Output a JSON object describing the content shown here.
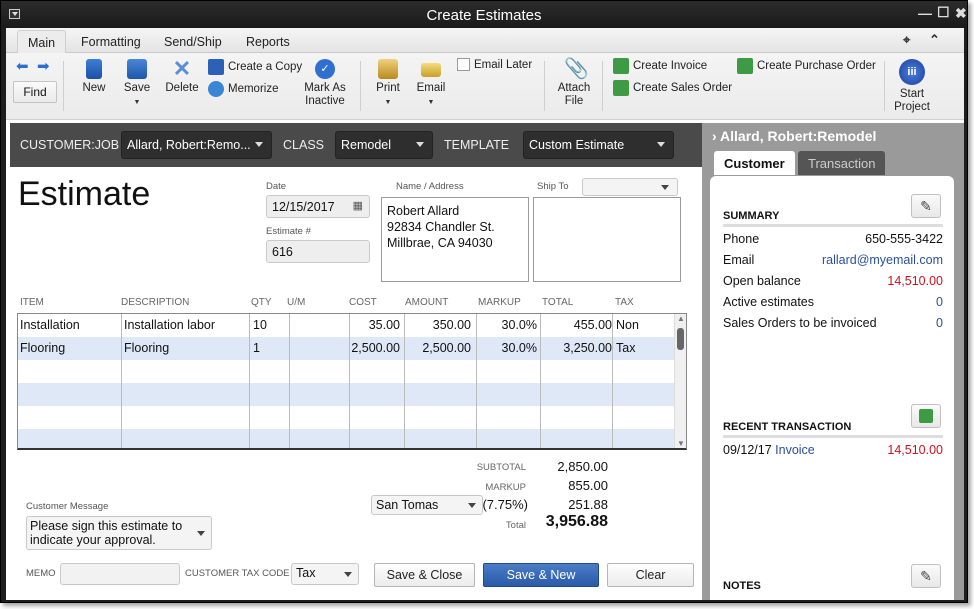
{
  "window": {
    "title": "Create Estimates"
  },
  "tabs": [
    {
      "label": "Main",
      "active": true
    },
    {
      "label": "Formatting",
      "active": false
    },
    {
      "label": "Send/Ship",
      "active": false
    },
    {
      "label": "Reports",
      "active": false
    }
  ],
  "ribbon": {
    "find": "Find",
    "new": "New",
    "save": "Save",
    "delete": "Delete",
    "create_copy": "Create a Copy",
    "memorize": "Memorize",
    "mark_inactive_1": "Mark As",
    "mark_inactive_2": "Inactive",
    "print": "Print",
    "email": "Email",
    "email_later": "Email Later",
    "attach_1": "Attach",
    "attach_2": "File",
    "create_invoice": "Create Invoice",
    "create_sales_order": "Create Sales Order",
    "create_po": "Create Purchase Order",
    "start_project_1": "Start",
    "start_project_2": "Project"
  },
  "customer_bar": {
    "customer_job_label": "CUSTOMER:JOB",
    "customer_job_value": "Allard, Robert:Remo...",
    "class_label": "CLASS",
    "class_value": "Remodel",
    "template_label": "TEMPLATE",
    "template_value": "Custom Estimate"
  },
  "form": {
    "title": "Estimate",
    "date_label": "Date",
    "date_value": "12/15/2017",
    "estimate_no_label": "Estimate #",
    "estimate_no_value": "616",
    "name_address_label": "Name / Address",
    "address_lines": [
      "Robert Allard",
      "92834 Chandler St.",
      "Millbrae, CA 94030"
    ],
    "ship_to_label": "Ship To",
    "ship_to_value": ""
  },
  "grid": {
    "columns": [
      "ITEM",
      "DESCRIPTION",
      "QTY",
      "U/M",
      "COST",
      "AMOUNT",
      "MARKUP",
      "TOTAL",
      "TAX"
    ],
    "rows": [
      {
        "item": "Installation",
        "description": "Installation labor",
        "qty": "10",
        "um": "",
        "cost": "35.00",
        "amount": "350.00",
        "markup": "30.0%",
        "total": "455.00",
        "tax": "Non"
      },
      {
        "item": "Flooring",
        "description": "Flooring",
        "qty": "1",
        "um": "",
        "cost": "2,500.00",
        "amount": "2,500.00",
        "markup": "30.0%",
        "total": "3,250.00",
        "tax": "Tax"
      }
    ]
  },
  "totals": {
    "subtotal_label": "SUBTOTAL",
    "subtotal_value": "2,850.00",
    "markup_label": "MARKUP",
    "markup_value": "855.00",
    "tax_item": "San Tomas",
    "tax_rate": "(7.75%)",
    "tax_value": "251.88",
    "total_label": "Total",
    "total_value": "3,956.88"
  },
  "footer": {
    "customer_message_label": "Customer Message",
    "customer_message_value": "Please sign this estimate to indicate your approval.",
    "memo_label": "MEMO",
    "memo_value": "",
    "tax_code_label": "CUSTOMER TAX CODE",
    "tax_code_value": "Tax",
    "save_close": "Save & Close",
    "save_new": "Save & New",
    "clear": "Clear"
  },
  "sidebar": {
    "header": "Allard, Robert:Remodel",
    "tabs": [
      "Customer",
      "Transaction"
    ],
    "summary_title": "SUMMARY",
    "summary": [
      {
        "label": "Phone",
        "value": "650-555-3422"
      },
      {
        "label": "Email",
        "value": "rallard@myemail.com"
      },
      {
        "label": "Open balance",
        "value": "14,510.00"
      },
      {
        "label": "Active estimates",
        "value": "0"
      },
      {
        "label": "Sales Orders to be invoiced",
        "value": "0"
      }
    ],
    "recent_title": "RECENT TRANSACTION",
    "recent": [
      {
        "date": "09/12/17",
        "type": "Invoice",
        "amount": "14,510.00"
      }
    ],
    "notes_title": "NOTES"
  },
  "colors": {
    "accent_blue": "#2a5aa8",
    "link_blue": "#2a4fa0",
    "balance_red": "#d0121c",
    "alt_row": "#dfe8f7"
  }
}
